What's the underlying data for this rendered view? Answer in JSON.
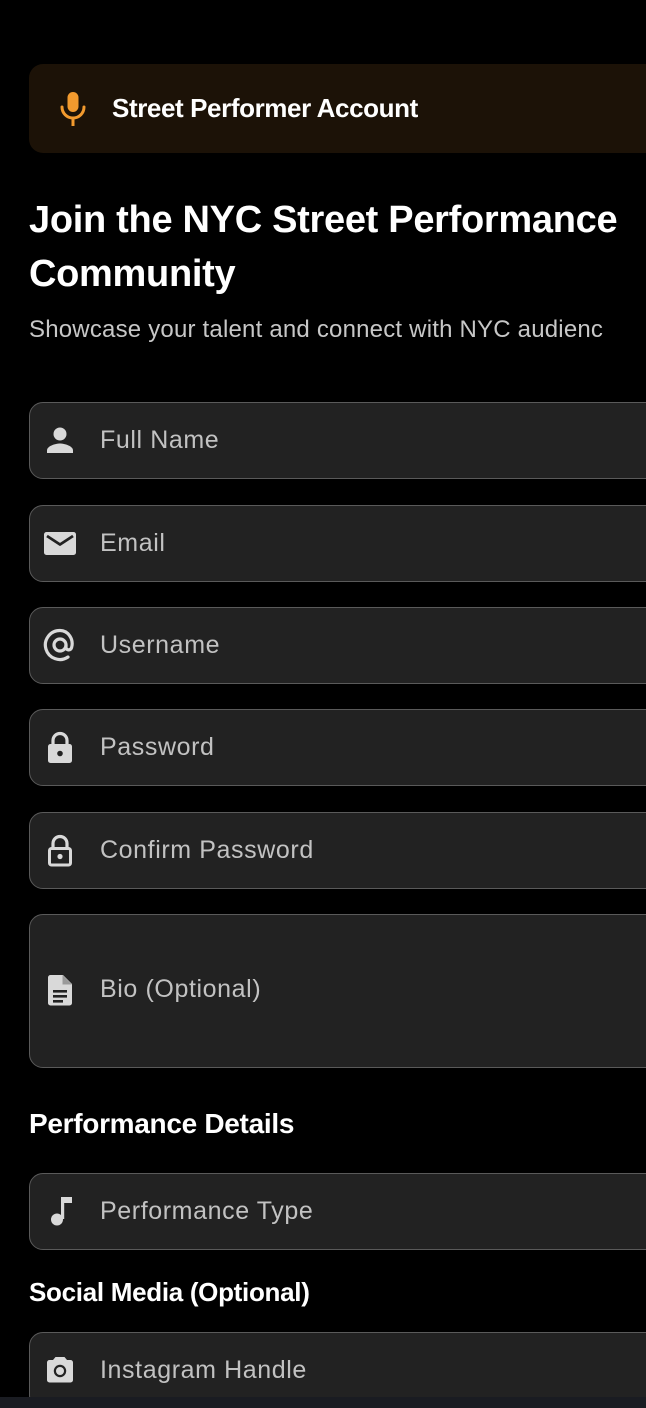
{
  "banner": {
    "icon": "microphone-icon",
    "title": "Street Performer Account",
    "accent_color": "#f29a2e"
  },
  "header": {
    "title": "Join the NYC Street Performance Community",
    "subtitle": "Showcase your talent and connect with NYC audienc"
  },
  "form": {
    "full_name": {
      "icon": "person-icon",
      "placeholder": "Full Name",
      "value": ""
    },
    "email": {
      "icon": "mail-icon",
      "placeholder": "Email",
      "value": ""
    },
    "username": {
      "icon": "at-sign-icon",
      "placeholder": "Username",
      "value": ""
    },
    "password": {
      "icon": "lock-icon",
      "placeholder": "Password",
      "value": ""
    },
    "confirm_password": {
      "icon": "lock-open-icon",
      "placeholder": "Confirm Password",
      "value": ""
    },
    "bio": {
      "icon": "document-icon",
      "placeholder": "Bio (Optional)",
      "value": ""
    }
  },
  "performance": {
    "section_title": "Performance Details",
    "type": {
      "icon": "music-note-icon",
      "placeholder": "Performance Type"
    }
  },
  "social": {
    "section_title": "Social Media (Optional)",
    "instagram": {
      "icon": "camera-icon",
      "placeholder": "Instagram Handle",
      "value": ""
    }
  },
  "colors": {
    "background": "#000000",
    "field_background": "#222222",
    "field_border": "#5a5a5a",
    "icon": "#d9d9d9",
    "banner_background": "#1c1207"
  }
}
